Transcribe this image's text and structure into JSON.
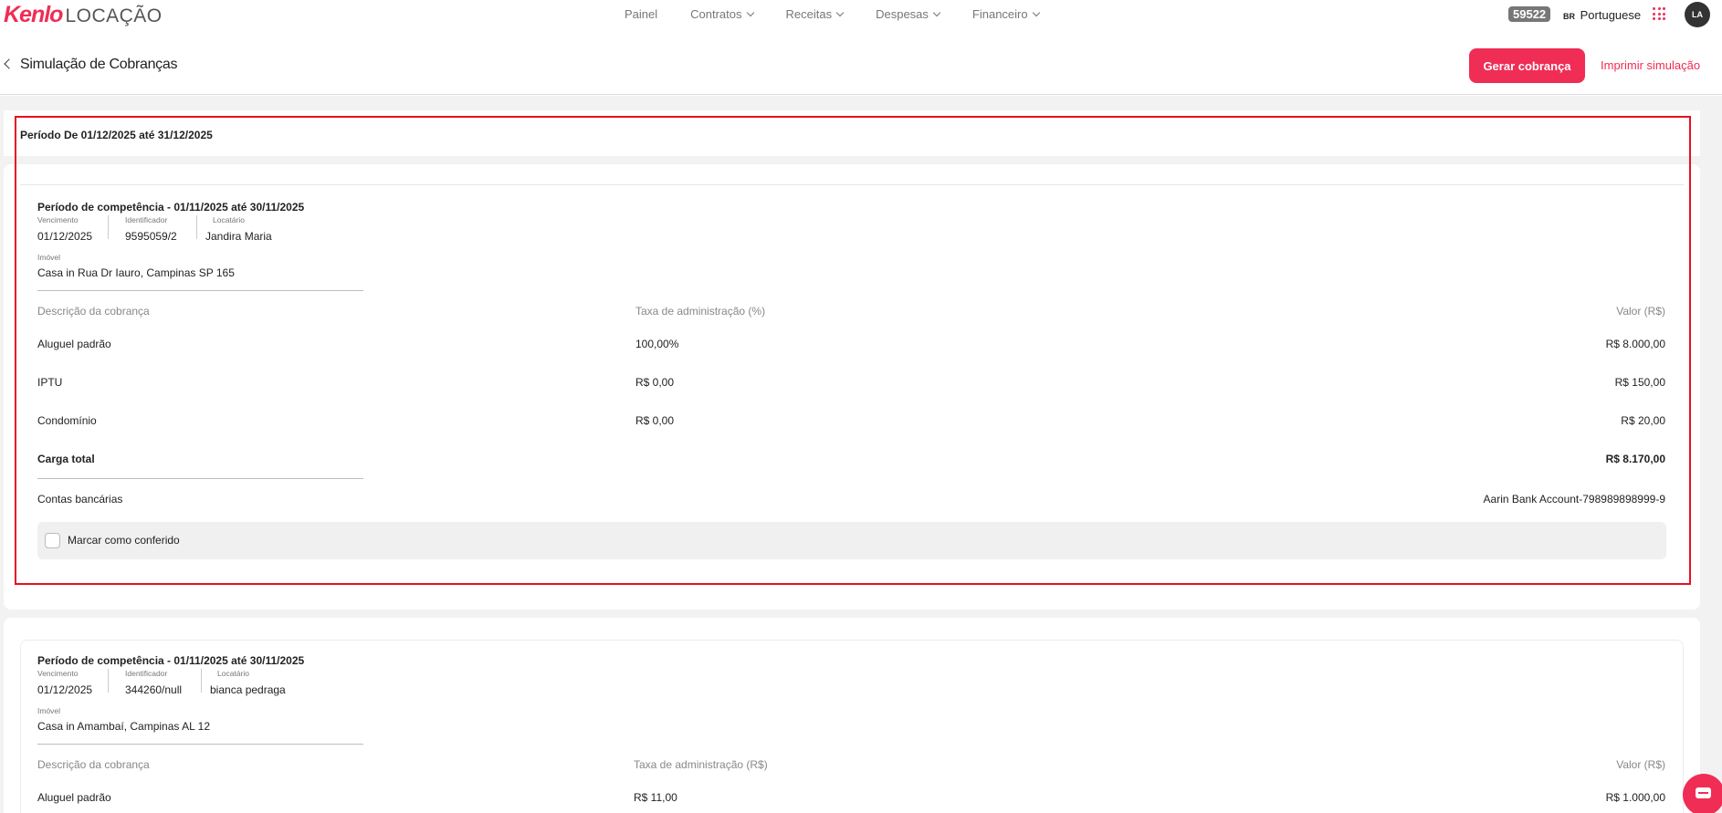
{
  "brand": {
    "name": "Kenlo",
    "product": "LOCAÇÃO",
    "accent_color": "#f02d55"
  },
  "nav": {
    "items": [
      {
        "label": "Painel",
        "has_dropdown": false
      },
      {
        "label": "Contratos",
        "has_dropdown": true
      },
      {
        "label": "Receitas",
        "has_dropdown": true
      },
      {
        "label": "Despesas",
        "has_dropdown": true
      },
      {
        "label": "Financeiro",
        "has_dropdown": true
      }
    ]
  },
  "toolbar": {
    "badge": "59522",
    "language_flag": "BR",
    "language": "Portuguese",
    "apps_icon": "grid-icon",
    "avatar_initials": "LA"
  },
  "header": {
    "title": "Simulação de Cobranças",
    "primary_button": "Gerar cobrança",
    "print_link": "Imprimir simulação"
  },
  "period": {
    "label": "Período De 01/12/2025 até 31/12/2025"
  },
  "cards": [
    {
      "competence": "Período de competência - 01/11/2025 até 30/11/2025",
      "due_label": "Vencimento",
      "due": "01/12/2025",
      "id_label": "Identificador",
      "id": "9595059/2",
      "tenant_label": "Locatário",
      "tenant": "Jandira Maria",
      "property_label": "Imóvel",
      "property": "Casa in Rua Dr Iauro, Campinas SP 165",
      "columns": [
        "Descrição da cobrança",
        "Taxa de administração (%)",
        "Valor (R$)"
      ],
      "rows": [
        {
          "desc": "Aluguel padrão",
          "fee": "100,00%",
          "value": "R$ 8.000,00"
        },
        {
          "desc": "IPTU",
          "fee": "R$ 0,00",
          "value": "R$ 150,00"
        },
        {
          "desc": "Condomínio",
          "fee": "R$ 0,00",
          "value": "R$ 20,00"
        }
      ],
      "total_label": "Carga total",
      "total_value": "R$ 8.170,00",
      "bank_label": "Contas bancárias",
      "bank_value": "Aarin Bank Account-798989898999-9",
      "check_label": "Marcar como conferido"
    },
    {
      "competence": "Período de competência - 01/11/2025 até 30/11/2025",
      "due_label": "Vencimento",
      "due": "01/12/2025",
      "id_label": "Identificador",
      "id": "344260/null",
      "tenant_label": "Locatário",
      "tenant": "bianca pedraga",
      "property_label": "Imóvel",
      "property": "Casa in Amambaí, Campinas AL 12",
      "columns": [
        "Descrição da cobrança",
        "Taxa de administração (R$)",
        "Valor (R$)"
      ],
      "rows": [
        {
          "desc": "Aluguel padrão",
          "fee": "R$ 11,00",
          "value": "R$ 1.000,00"
        }
      ]
    }
  ]
}
